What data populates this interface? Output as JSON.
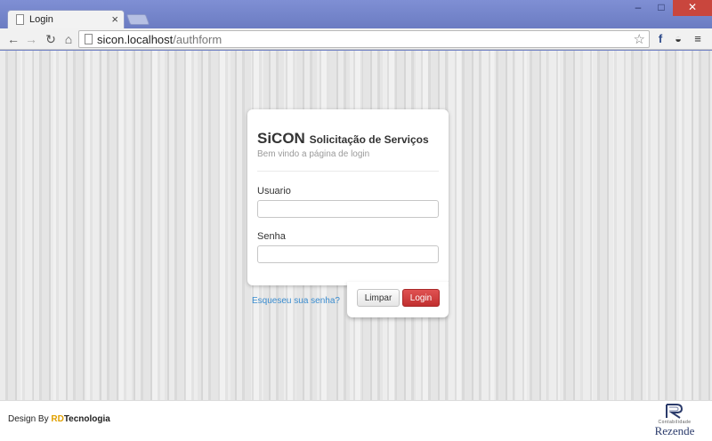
{
  "browser": {
    "tab_title": "Login",
    "tab_close": "×",
    "url_host": "sicon.localhost",
    "url_path": "/authform",
    "window_controls": {
      "minimize": "–",
      "maximize": "□",
      "close": "✕"
    },
    "nav": {
      "back": "←",
      "forward": "→",
      "reload": "↻",
      "home": "⌂"
    },
    "extensions": [
      {
        "name": "facebook-icon",
        "glyph": "f"
      },
      {
        "name": "mask-icon",
        "glyph": "◒"
      },
      {
        "name": "menu-icon",
        "glyph": "≡"
      }
    ],
    "star": "☆"
  },
  "login": {
    "brand": "SiCON",
    "brand_subtitle": "Solicitação de Serviços",
    "welcome": "Bem vindo a página de login",
    "username_label": "Usuario",
    "username_value": "",
    "password_label": "Senha",
    "password_value": "",
    "forgot_link": "Esqueseu sua senha?",
    "clear_button": "Limpar",
    "login_button": "Login"
  },
  "footer": {
    "design_by": "Design By ",
    "company_rd": "RD",
    "company_rest": "Tecnologia",
    "logo_small_text": "Contabilidade",
    "logo_name": "Rezende"
  },
  "colors": {
    "titlebar": "#6f80c4",
    "login_button": "#c9383a",
    "link": "#3a8ccf",
    "rd_accent": "#e0a000"
  }
}
